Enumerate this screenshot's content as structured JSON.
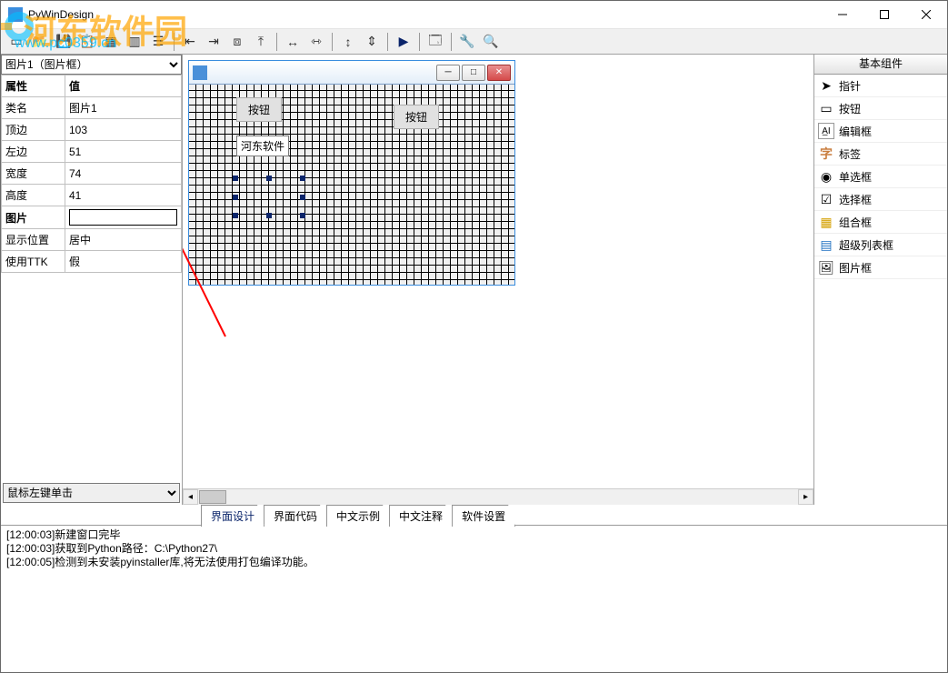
{
  "titlebar": {
    "title": "PyWinDesign"
  },
  "watermark": {
    "big": "河东软件园",
    "url": "www.pc0359.cn"
  },
  "left_select": "图片1（图片框）",
  "prop_header": {
    "col1": "属性",
    "col2": "值"
  },
  "props": [
    {
      "k": "类名",
      "v": "图片1",
      "bold": false
    },
    {
      "k": "顶边",
      "v": "103",
      "bold": false
    },
    {
      "k": "左边",
      "v": "51",
      "bold": false
    },
    {
      "k": "宽度",
      "v": "74",
      "bold": false
    },
    {
      "k": "高度",
      "v": "41",
      "bold": false
    },
    {
      "k": "图片",
      "v": "",
      "bold": true,
      "input": true
    },
    {
      "k": "显示位置",
      "v": "居中",
      "bold": false
    },
    {
      "k": "使用TTK",
      "v": "假",
      "bold": false
    }
  ],
  "left_bottom_select": "鼠标左键单击",
  "design_form": {
    "title": "",
    "button1": "按钮",
    "button2": "按钮",
    "entry1": "河东软件"
  },
  "right_panel": {
    "header": "基本组件",
    "items": [
      {
        "name": "pointer",
        "label": "指针",
        "iconChar": "➤"
      },
      {
        "name": "button",
        "label": "按钮",
        "iconChar": "▭"
      },
      {
        "name": "entry",
        "label": "编辑框",
        "iconChar": "A̲I"
      },
      {
        "name": "label",
        "label": "标签",
        "iconChar": "字"
      },
      {
        "name": "radio",
        "label": "单选框",
        "iconChar": "◉"
      },
      {
        "name": "check",
        "label": "选择框",
        "iconChar": "☑"
      },
      {
        "name": "combo",
        "label": "组合框",
        "iconChar": "▦"
      },
      {
        "name": "listview",
        "label": "超级列表框",
        "iconChar": "▤"
      },
      {
        "name": "picture",
        "label": "图片框",
        "iconChar": "🖼"
      }
    ]
  },
  "tabs": [
    {
      "label": "界面设计",
      "active": true
    },
    {
      "label": "界面代码",
      "active": false
    },
    {
      "label": "中文示例",
      "active": false
    },
    {
      "label": "中文注释",
      "active": false
    },
    {
      "label": "软件设置",
      "active": false
    }
  ],
  "log_lines": [
    "[12:00:03]新建窗口完毕",
    "[12:00:03]获取到Python路径：C:\\Python27\\",
    "[12:00:05]检测到未安装pyinstaller库,将无法使用打包编译功能。"
  ]
}
